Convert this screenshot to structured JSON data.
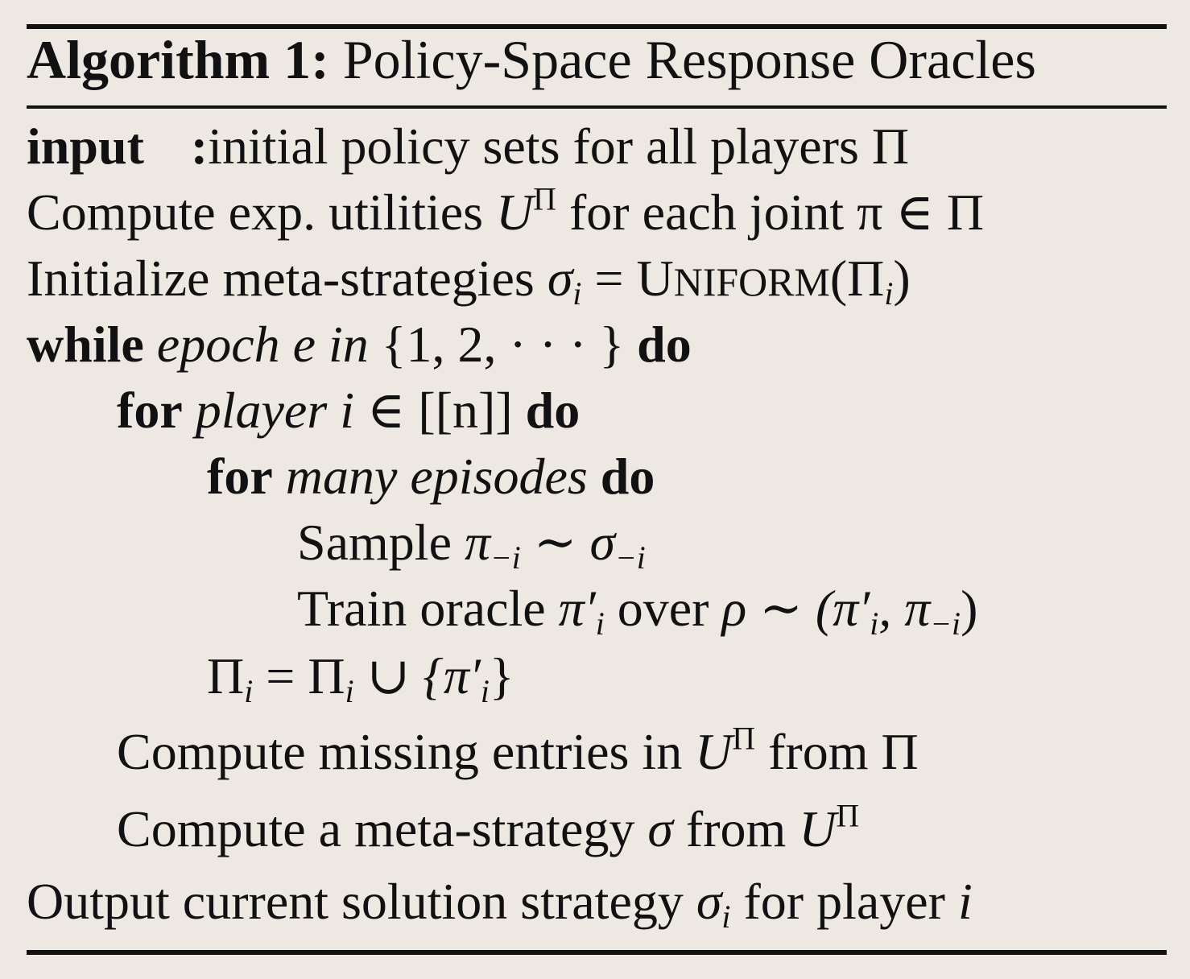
{
  "algorithm": {
    "label": "Algorithm 1:",
    "title": "Policy-Space Response Oracles"
  },
  "lines": {
    "input_keyword": "input",
    "input_colon": ":",
    "input_text": "initial policy sets for all players Π",
    "compute_text": "Compute exp. utilities ",
    "compute_U": "U",
    "compute_U_sup": "Π",
    "compute_tail": " for each joint π ∈ Π",
    "init_text": "Initialize meta-strategies ",
    "init_sigma": "σ",
    "init_sigma_sub": "i",
    "init_eq": " = ",
    "init_func_first": "U",
    "init_func_rest": "NIFORM",
    "init_arg_open": "(Π",
    "init_arg_sub": "i",
    "init_arg_close": ")",
    "while_kw": "while",
    "while_text": " epoch ",
    "while_e": "e",
    "while_in": " in ",
    "while_set": "{1, 2, · · · }",
    "while_do": " do",
    "for1_kw": "for",
    "for1_text": " player ",
    "for1_i": "i",
    "for1_set": " ∈ [[n]]",
    "for1_do": " do",
    "for2_kw": "for",
    "for2_text": " many episodes",
    "for2_do": " do",
    "sample_text": "Sample ",
    "sample_pi": "π",
    "sample_pi_sub": "−i",
    "sample_sim": " ∼ ",
    "sample_sigma": "σ",
    "sample_sigma_sub": "−i",
    "train_text": "Train oracle ",
    "train_pi": "π′",
    "train_pi_sub": "i",
    "train_over": " over ",
    "train_rho": "ρ ∼ (π′",
    "train_rho_sub": "i",
    "train_rest": ", π",
    "train_rest_sub": "−i",
    "train_close": ")",
    "update_pi": "Π",
    "update_sub": "i",
    "update_eq": " = Π",
    "update_sub2": "i",
    "update_union": " ∪ {π′",
    "update_sub3": "i",
    "update_close": "}",
    "missing_text": "Compute missing entries in ",
    "missing_U": "U",
    "missing_U_sup": "Π",
    "missing_tail": " from Π",
    "meta_text": "Compute a meta-strategy ",
    "meta_sigma": "σ",
    "meta_from": " from ",
    "meta_U": "U",
    "meta_U_sup": "Π",
    "output_text": "Output current solution strategy ",
    "output_sigma": "σ",
    "output_sub": "i",
    "output_tail": " for player ",
    "output_i": "i"
  }
}
